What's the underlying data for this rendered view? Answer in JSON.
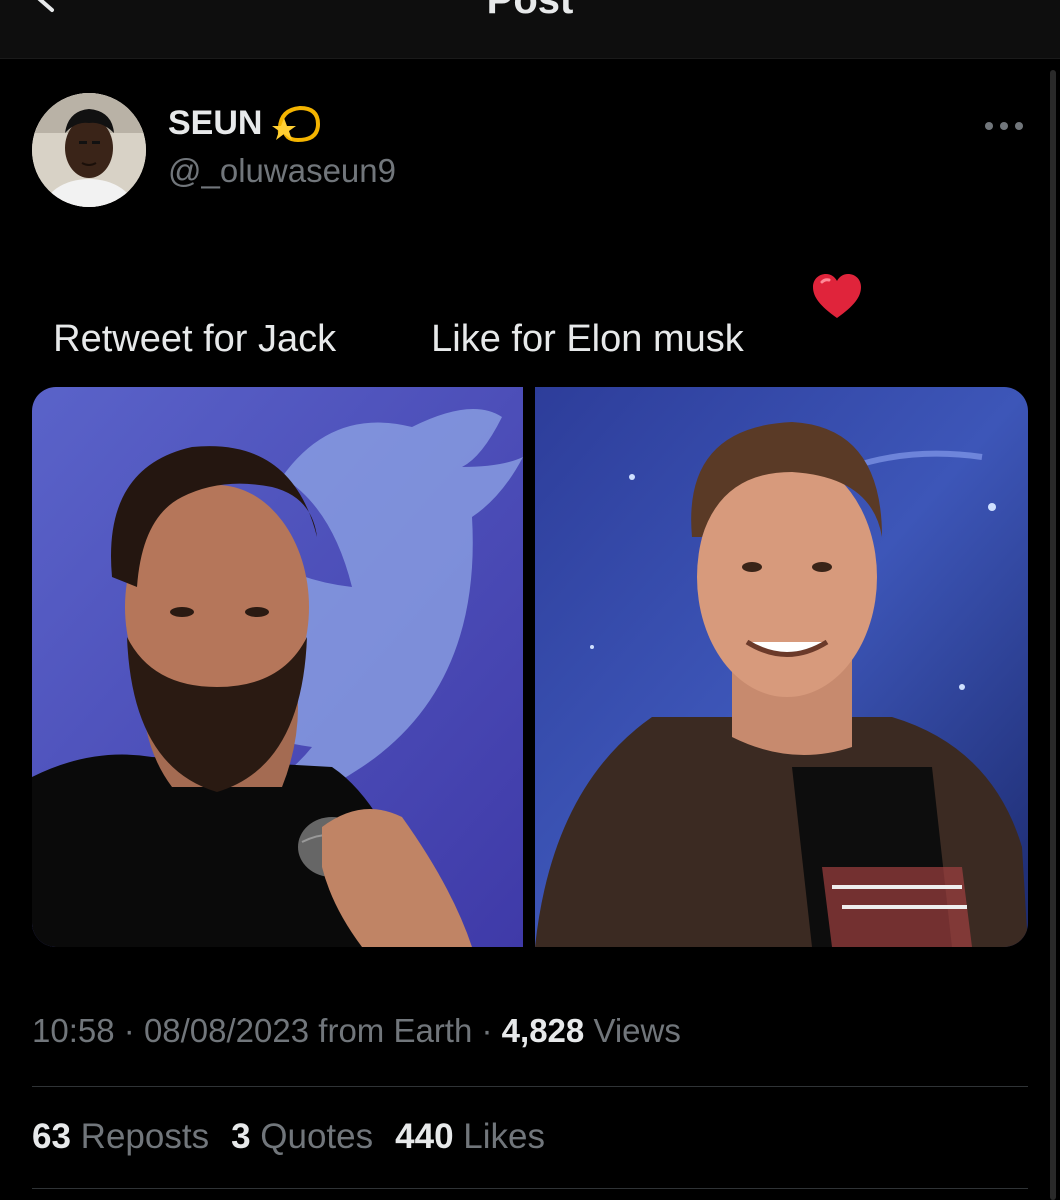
{
  "header": {
    "title": "Post",
    "back_icon": "arrow-left-icon"
  },
  "author": {
    "display_name": "SEUN",
    "name_emoji_icon": "dizzy-comet-icon",
    "handle": "@_oluwaseun9"
  },
  "post": {
    "text_part1": "Retweet for Jack",
    "text_part2": "Like for Elon musk",
    "heart_icon": "red-heart-icon",
    "more_icon": "more-horizontal-icon"
  },
  "meta": {
    "time": "10:58",
    "date": "08/08/2023",
    "source": "from Earth",
    "views_count": "4,828",
    "views_label": "Views",
    "separator": "·"
  },
  "stats": {
    "reposts_count": "63",
    "reposts_label": "Reposts",
    "quotes_count": "3",
    "quotes_label": "Quotes",
    "likes_count": "440",
    "likes_label": "Likes"
  },
  "colors": {
    "background": "#000000",
    "text_primary": "#e7e9ea",
    "text_secondary": "#71767b",
    "divider": "#2f3336",
    "heart": "#e0243b"
  }
}
